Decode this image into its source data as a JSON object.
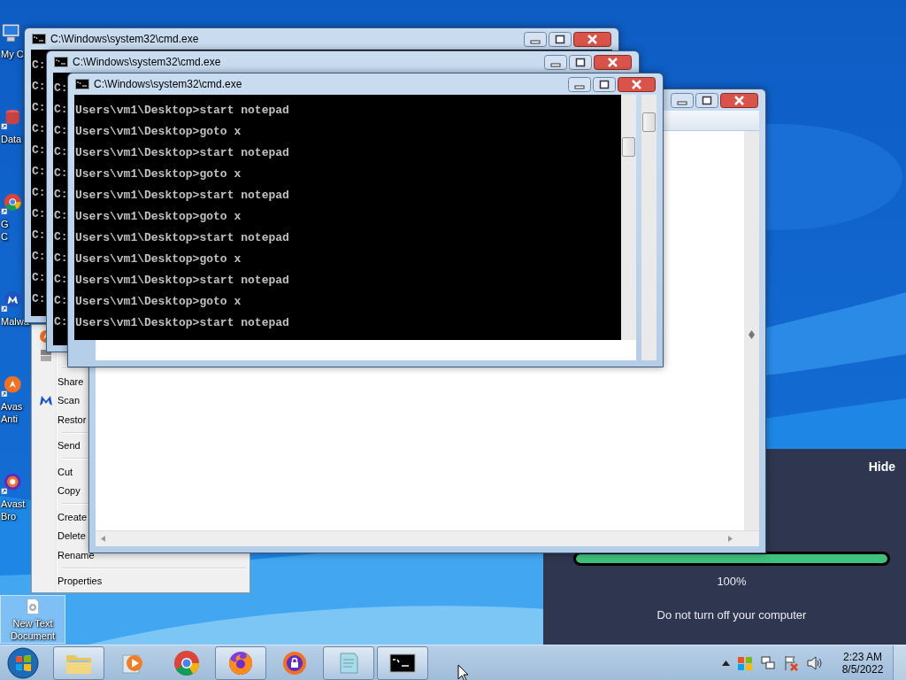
{
  "desktop_icons": [
    {
      "kind": "computer",
      "lines": [
        "My C"
      ],
      "selected": false
    },
    {
      "kind": "database",
      "lines": [
        "Data"
      ],
      "selected": false
    },
    {
      "kind": "chrome",
      "lines": [
        "G",
        "C"
      ],
      "selected": false
    },
    {
      "kind": "malwarebytes",
      "lines": [
        "Malwa"
      ],
      "selected": false
    },
    {
      "kind": "avast",
      "lines": [
        "Avas",
        "Anti"
      ],
      "selected": false
    },
    {
      "kind": "avast-browser",
      "lines": [
        "Avast",
        "Bro"
      ],
      "selected": false
    },
    {
      "kind": "text-file",
      "lines": [
        "New Text",
        "Document"
      ],
      "selected": true
    }
  ],
  "context_menu": {
    "groups": [
      [
        {
          "kind": "avast"
        },
        {
          "kind": "shredder"
        }
      ],
      [
        {
          "label": "Share"
        },
        {
          "kind": "malwarebytes",
          "label": "Scan"
        },
        {
          "label": "Restor"
        }
      ],
      [
        {
          "label": "Send"
        }
      ],
      [
        {
          "label": "Cut"
        },
        {
          "label": "Copy"
        }
      ],
      [
        {
          "label": "Create"
        },
        {
          "label": "Delete"
        },
        {
          "label": "Rename"
        }
      ],
      [
        {
          "label": "Properties"
        }
      ]
    ]
  },
  "update_panel": {
    "action": "Hide",
    "progress": {
      "level": 1
    },
    "percent": "100%",
    "message": "Do not turn off your computer"
  },
  "windows": [
    {
      "kind": "notepad"
    },
    {
      "kind": "cmd",
      "title": "C:\\Windows\\system32\\cmd.exe",
      "lines": [
        "C:",
        "C:",
        "C:",
        "C:",
        "C:",
        "C:",
        "C:",
        "C:",
        "C:",
        "C:",
        "C:",
        "C:"
      ]
    },
    {
      "kind": "cmd",
      "title": "C:\\Windows\\system32\\cmd.exe",
      "lines": [
        "C:",
        "C:",
        "C:",
        "C:",
        "C:",
        "C:",
        "C:",
        "C:",
        "C:",
        "C:",
        "C:",
        "C:"
      ]
    },
    {
      "kind": "cmd",
      "title": "C:\\Windows\\system32\\cmd.exe",
      "lines": [
        "Users\\vm1\\Desktop>start notepad",
        "Users\\vm1\\Desktop>goto x",
        "Users\\vm1\\Desktop>start notepad",
        "Users\\vm1\\Desktop>goto x",
        "Users\\vm1\\Desktop>start notepad",
        "Users\\vm1\\Desktop>goto x",
        "Users\\vm1\\Desktop>start notepad",
        "Users\\vm1\\Desktop>goto x",
        "Users\\vm1\\Desktop>start notepad",
        "Users\\vm1\\Desktop>goto x",
        "Users\\vm1\\Desktop>start notepad"
      ]
    }
  ],
  "taskbar": {
    "items": [
      {
        "kind": "explorer",
        "running": true
      },
      {
        "kind": "media",
        "running": false
      },
      {
        "kind": "chrome",
        "running": false
      },
      {
        "kind": "firefox",
        "running": true
      },
      {
        "kind": "avast-browser",
        "running": false
      },
      {
        "kind": "notepad",
        "running": true
      },
      {
        "kind": "cmd",
        "running": true
      }
    ],
    "clock": {
      "time": "2:23 AM",
      "date": "8/5/2022"
    }
  }
}
